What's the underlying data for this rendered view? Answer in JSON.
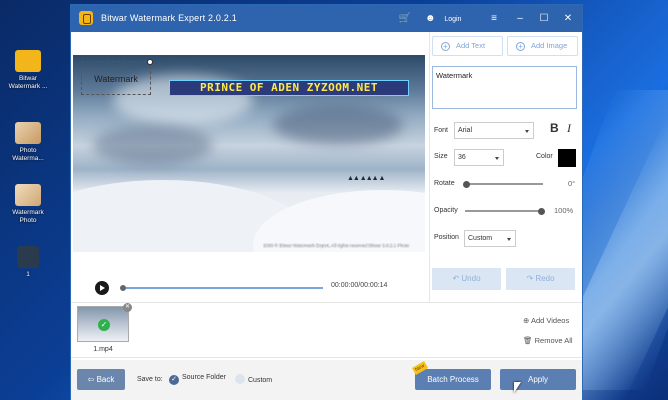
{
  "desktop": {
    "icons": [
      {
        "label": "Bitwar Watermark ..."
      },
      {
        "label": "Photo Waterma..."
      },
      {
        "label": "Watermark Photo"
      },
      {
        "label": "1"
      }
    ]
  },
  "window": {
    "title": "Bitwar Watermark Expert  2.0.2.1",
    "login_label": "Login"
  },
  "preview": {
    "watermark_text": "Watermark",
    "banner_text": "PRINCE OF ADEN ZYZOOM.NET",
    "copyright_text": "2009 © Bitwar Watermark Expert, All rights reserved Bitwar 2.0.2.1 Photo"
  },
  "player": {
    "time": "00:00:00/00:00:14",
    "progress_fraction": 0.0
  },
  "panel": {
    "add_text_label": "Add Text",
    "add_image_label": "Add Image",
    "text_value": "Watermark",
    "font_label": "Font",
    "font_value": "Arial",
    "bold_label": "B",
    "italic_label": "I",
    "size_label": "Size",
    "size_value": "36",
    "color_label": "Color",
    "color_value": "#000000",
    "rotate_label": "Rotate",
    "rotate_value": "0°",
    "opacity_label": "Opacity",
    "opacity_value": "100%",
    "position_label": "Position",
    "position_value": "Custom",
    "undo_label": "Undo",
    "redo_label": "Redo"
  },
  "files": {
    "items": [
      {
        "name": "1.mp4"
      }
    ],
    "add_videos_label": "Add Videos",
    "remove_all_label": "Remove All"
  },
  "footer": {
    "back_label": "Back",
    "save_to_label": "Save to:",
    "source_folder_label": "Source Folder",
    "custom_label": "Custom",
    "batch_badge": "New",
    "batch_process_label": "Batch Process",
    "apply_label": "Apply"
  },
  "colors": {
    "titlebar": "#2e63ad",
    "accent": "#5b7fb2",
    "disabled_button": "#dbe6f4"
  }
}
